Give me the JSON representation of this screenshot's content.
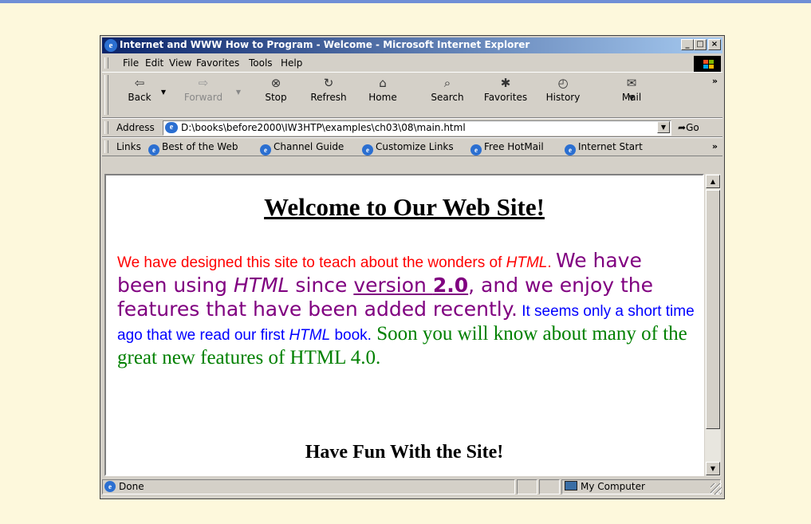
{
  "window": {
    "title": "Internet and WWW How to Program - Welcome - Microsoft Internet Explorer",
    "minimize": "_",
    "maximize": "□",
    "close": "×"
  },
  "menu": [
    "File",
    "Edit",
    "View",
    "Favorites",
    "Tools",
    "Help"
  ],
  "toolbar": {
    "back": "Back",
    "forward": "Forward",
    "stop": "Stop",
    "refresh": "Refresh",
    "home": "Home",
    "search": "Search",
    "favorites": "Favorites",
    "history": "History",
    "mail": "Mail",
    "more": "»"
  },
  "address": {
    "label": "Address",
    "url": "D:\\books\\before2000\\IW3HTP\\examples\\ch03\\08\\main.html",
    "go": "Go"
  },
  "links": {
    "label": "Links",
    "items": [
      "Best of the Web",
      "Channel Guide",
      "Customize Links",
      "Free HotMail",
      "Internet Start"
    ],
    "more": "»"
  },
  "page": {
    "heading": "Welcome to Our Web Site!",
    "red_text": "We have designed this site to teach about the wonders of ",
    "red_em": "HTML",
    "red_end": ". ",
    "purple_1": "We have been using ",
    "purple_em": "HTML",
    "purple_2": " since ",
    "purple_link": "version ",
    "purple_link_bold": "2.0",
    "purple_3": ", and we enjoy the features that have been added recently.",
    "blue_1": " It seems only a short time ago that we read our first ",
    "blue_em": "HTML",
    "blue_2": " book.",
    "green": " Soon you will know about many of the great new features of HTML 4.0.",
    "closing": "Have Fun With the Site!"
  },
  "status": {
    "text": "Done",
    "zone": "My Computer"
  },
  "colors": {
    "titlebar_start": "#0a246a",
    "titlebar_end": "#a6caf0",
    "chrome": "#d4d0c8",
    "background": "#fdf8dc"
  }
}
